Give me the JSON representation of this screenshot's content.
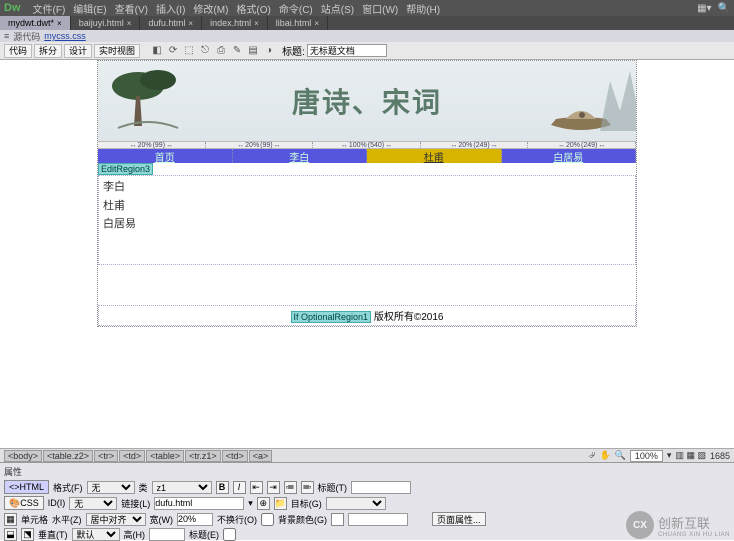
{
  "menu": {
    "items": [
      "文件(F)",
      "编辑(E)",
      "查看(V)",
      "插入(I)",
      "修改(M)",
      "格式(O)",
      "命令(C)",
      "站点(S)",
      "窗口(W)",
      "帮助(H)"
    ],
    "logo": "Dw"
  },
  "tabs": {
    "items": [
      {
        "label": "mydwt.dwt*",
        "active": true
      },
      {
        "label": "baijuyi.html",
        "active": false
      },
      {
        "label": "dufu.html",
        "active": false
      },
      {
        "label": "index.html",
        "active": false
      },
      {
        "label": "libai.html",
        "active": false
      }
    ]
  },
  "srcbar": {
    "label": "源代码",
    "file": "mycss.css"
  },
  "toolbar": {
    "views": [
      "代码",
      "拆分",
      "设计",
      "实时视图"
    ],
    "title_label": "标题:",
    "title_value": "无标题文档"
  },
  "banner": {
    "title": "唐诗、宋词"
  },
  "rulers": [
    {
      "pct": "20%",
      "px": "(99)"
    },
    {
      "pct": "20%",
      "px": "(99)"
    },
    {
      "pct": "100%",
      "px": "(540)"
    },
    {
      "pct": "20%",
      "px": "(249)"
    },
    {
      "pct": "20%",
      "px": "(249)"
    }
  ],
  "nav": {
    "items": [
      {
        "label": "首页",
        "active": false
      },
      {
        "label": "李白",
        "active": false
      },
      {
        "label": "杜甫",
        "active": true
      },
      {
        "label": "白居易",
        "active": false
      }
    ]
  },
  "editregion": "EditRegion3",
  "content_lines": [
    "李白",
    "杜甫",
    "白居易"
  ],
  "optregion": {
    "tag": "If OptionalRegion1",
    "copy": "版权所有©2016"
  },
  "tagselector": {
    "path": [
      "<body>",
      "<table.z2>",
      "<tr>",
      "<td>",
      "<table>",
      "<tr.z1>",
      "<td>",
      "<a>"
    ],
    "zoom": "100%",
    "size": "1685"
  },
  "properties": {
    "header": "属性",
    "mode": {
      "html": "HTML",
      "css": "CSS"
    },
    "row1": {
      "format_lbl": "格式(F)",
      "format_val": "无",
      "class_lbl": "类",
      "class_val": "z1",
      "title_lbl": "标题(T)"
    },
    "row2": {
      "id_lbl": "ID(I)",
      "id_val": "无",
      "link_lbl": "链接(L)",
      "link_val": "dufu.html",
      "target_lbl": "目标(G)"
    },
    "row3": {
      "cell_lbl": "单元格",
      "horz_lbl": "水平(Z)",
      "horz_val": "居中对齐",
      "width_lbl": "宽(W)",
      "width_val": "20%",
      "nowrap_lbl": "不换行(O)",
      "bg_lbl": "背景颜色(G)",
      "pageprops": "页面属性..."
    },
    "row4": {
      "vert_lbl": "垂直(T)",
      "vert_val": "默认",
      "height_lbl": "高(H)",
      "header_lbl": "标题(E)"
    }
  },
  "watermark": {
    "logo": "CX",
    "text": "创新互联",
    "sub": "CHUANG XIN HU LIAN"
  }
}
